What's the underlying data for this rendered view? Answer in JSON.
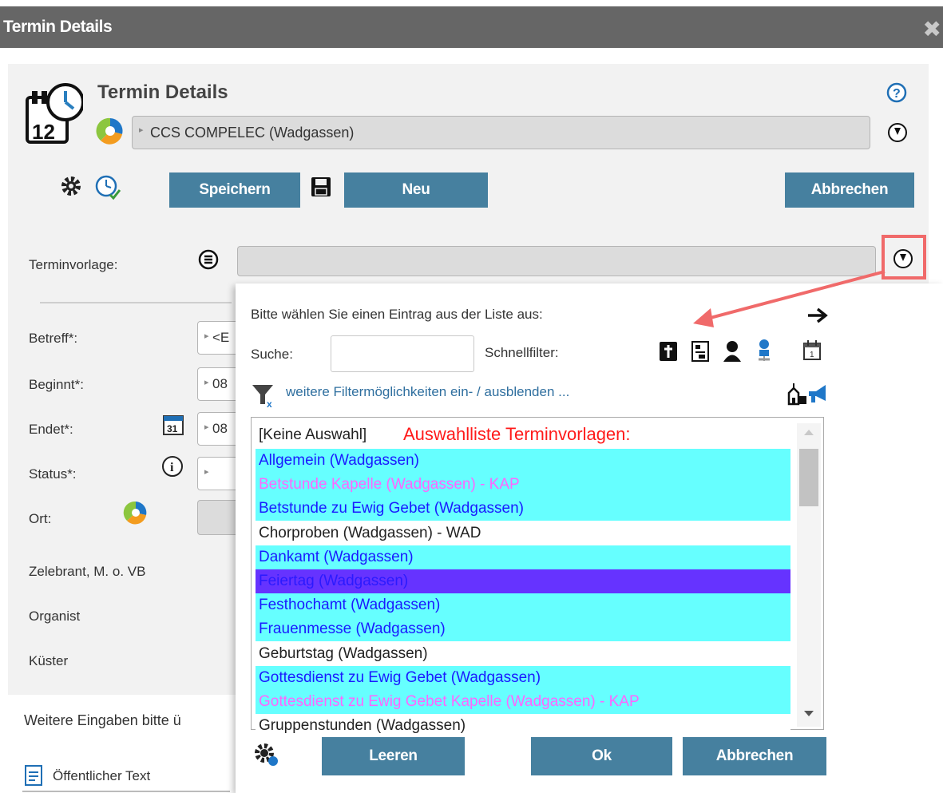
{
  "window": {
    "title": "Termin Details",
    "close_glyph": "✖"
  },
  "header": {
    "title": "Termin Details",
    "location_value": "CCS COMPELEC (Wadgassen)",
    "help_glyph": "?",
    "icons": [
      "calendar-clock-icon",
      "location-pie-icon",
      "gear-icon",
      "clock-check-icon",
      "floppy-icon",
      "download-circle-icon",
      "help-icon"
    ]
  },
  "toolbar": {
    "save_label": "Speichern",
    "new_label": "Neu",
    "cancel_label": "Abbrechen"
  },
  "form": {
    "template_label": "Terminvorlage:",
    "fields": [
      {
        "label": "Betreff*:",
        "value": "<E"
      },
      {
        "label": "Beginnt*:",
        "value": "08"
      },
      {
        "label": "Endet*:",
        "value": "08"
      },
      {
        "label": "Status*:",
        "value": ""
      },
      {
        "label": "Ort:",
        "value": ""
      }
    ],
    "calendar_glyph": "31",
    "info_glyph": "i",
    "people": [
      "Zelebrant, M. o. VB",
      "Organist",
      "Küster"
    ],
    "more_text": "Weitere Eingaben bitte ü",
    "public_text_label": "Öffentlicher Text"
  },
  "dropdown": {
    "prompt": "Bitte wählen Sie einen Eintrag aus der Liste aus:",
    "search_label": "Suche:",
    "search_value": "",
    "quickfilter_label": "Schnellfilter:",
    "filter_toggle": "weitere Filtermöglichkeiten ein- / ausblenden ...",
    "list_header": "[Keine Auswahl]",
    "list_title": "Auswahlliste Terminvorlagen:",
    "items": [
      {
        "text": "Allgemein (Wadgassen)",
        "bg": "#66ffff",
        "fg": "#1a1aff"
      },
      {
        "text": "Betstunde Kapelle (Wadgassen) - KAP",
        "bg": "#66ffff",
        "fg": "#ff66ff"
      },
      {
        "text": "Betstunde zu Ewig Gebet (Wadgassen)",
        "bg": "#66ffff",
        "fg": "#1a1aff"
      },
      {
        "text": "Chorproben (Wadgassen) - WAD",
        "bg": "#ffffff",
        "fg": "#222222"
      },
      {
        "text": "Dankamt (Wadgassen)",
        "bg": "#66ffff",
        "fg": "#1a1aff"
      },
      {
        "text": "Feiertag (Wadgassen)",
        "bg": "#6633ff",
        "fg": "#2b1aff"
      },
      {
        "text": "Festhochamt (Wadgassen)",
        "bg": "#66ffff",
        "fg": "#1a1aff"
      },
      {
        "text": "Frauenmesse (Wadgassen)",
        "bg": "#66ffff",
        "fg": "#1a1aff"
      },
      {
        "text": "Geburtstag (Wadgassen)",
        "bg": "#ffffff",
        "fg": "#222222"
      },
      {
        "text": "Gottesdienst zu Ewig Gebet (Wadgassen)",
        "bg": "#66ffff",
        "fg": "#1a1aff"
      },
      {
        "text": "Gottesdienst zu Ewig Gebet Kapelle (Wadgassen) - KAP",
        "bg": "#66ffff",
        "fg": "#ff66ff"
      },
      {
        "text": "Gruppenstunden (Wadgassen)",
        "bg": "#ffffff",
        "fg": "#222222"
      }
    ],
    "buttons": {
      "clear": "Leeren",
      "ok": "Ok",
      "cancel": "Abbrechen"
    },
    "quickfilter_icons": [
      "cross-book-icon",
      "document-icon",
      "person-icon",
      "seated-person-icon",
      "calendar-icon"
    ],
    "extra_icons": [
      "church-icon",
      "megaphone-icon",
      "filter-clear-icon",
      "gear-icon",
      "arrow-right-icon"
    ]
  },
  "colors": {
    "button": "#46809f",
    "title_red": "#ff1a1a",
    "link": "#2f6f9f",
    "highlight": "#f06a6a"
  }
}
